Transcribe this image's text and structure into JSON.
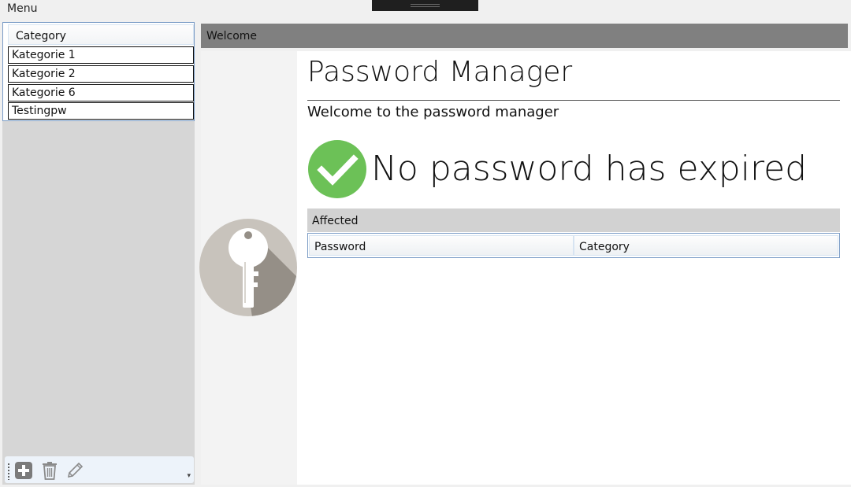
{
  "menu": {
    "label": "Menu"
  },
  "categories": {
    "header": "Category",
    "items": [
      "Kategorie 1",
      "Kategorie 2",
      "Kategorie 6",
      "Testingpw"
    ]
  },
  "toolbar": {
    "icons": [
      "add-icon",
      "delete-icon",
      "edit-icon"
    ],
    "overflow": "▾"
  },
  "tab": {
    "label": "Welcome"
  },
  "main": {
    "title": "Password Manager",
    "subtitle": "Welcome to the password manager",
    "status_text": "No password has expired",
    "status_color": "#6cc157",
    "affected_label": "Affected",
    "columns": [
      "Password",
      "Category"
    ]
  }
}
